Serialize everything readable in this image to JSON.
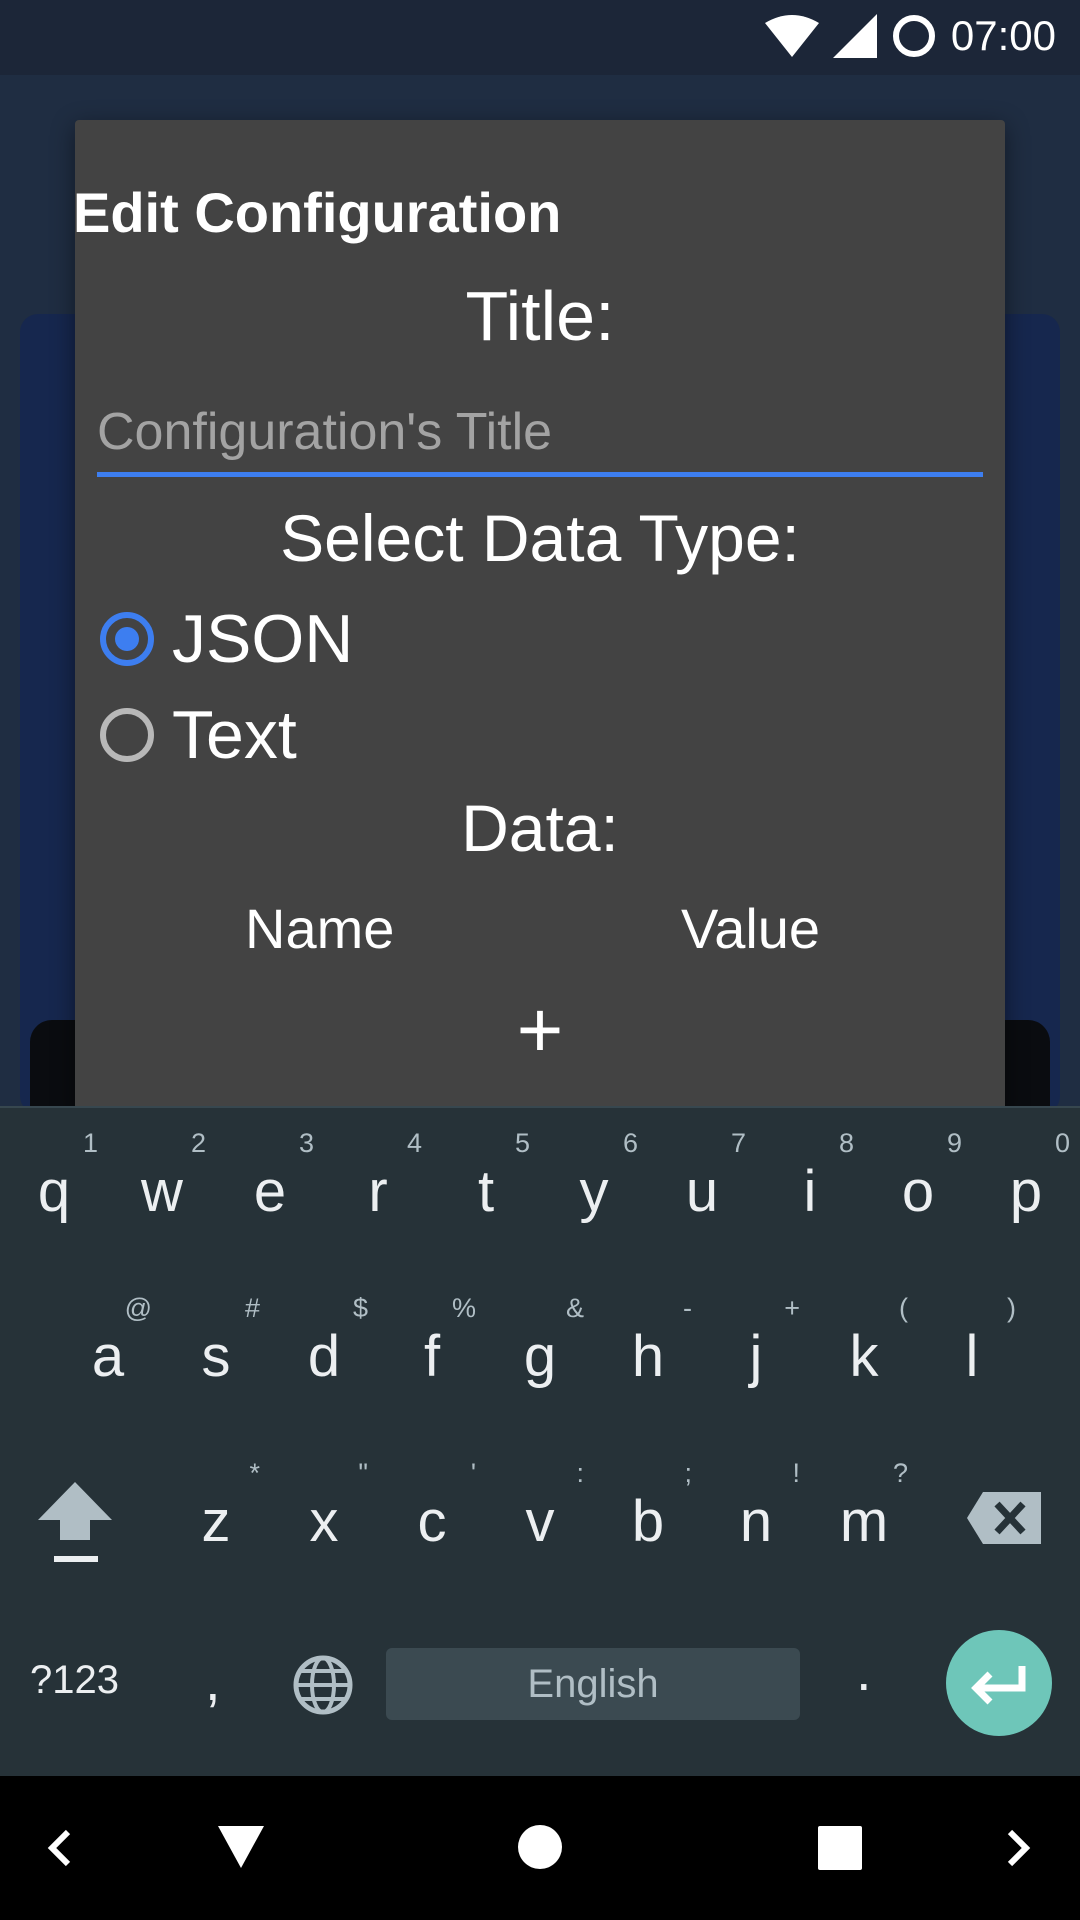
{
  "status_bar": {
    "time": "07:00",
    "icons": [
      "wifi-icon",
      "cell-signal-icon",
      "sync-icon"
    ]
  },
  "dialog": {
    "title": "Edit Configuration",
    "title_label": "Title:",
    "title_input": {
      "value": "",
      "placeholder": "Configuration's Title"
    },
    "data_type_label": "Select Data Type:",
    "data_types": [
      {
        "label": "JSON",
        "checked": true
      },
      {
        "label": "Text",
        "checked": false
      }
    ],
    "data_label": "Data:",
    "columns": [
      "Name",
      "Value"
    ],
    "add_label": "+"
  },
  "keyboard": {
    "rows": [
      [
        {
          "key": "q",
          "hint": "1"
        },
        {
          "key": "w",
          "hint": "2"
        },
        {
          "key": "e",
          "hint": "3"
        },
        {
          "key": "r",
          "hint": "4"
        },
        {
          "key": "t",
          "hint": "5"
        },
        {
          "key": "y",
          "hint": "6"
        },
        {
          "key": "u",
          "hint": "7"
        },
        {
          "key": "i",
          "hint": "8"
        },
        {
          "key": "o",
          "hint": "9"
        },
        {
          "key": "p",
          "hint": "0"
        }
      ],
      [
        {
          "key": "a",
          "hint": "@"
        },
        {
          "key": "s",
          "hint": "#"
        },
        {
          "key": "d",
          "hint": "$"
        },
        {
          "key": "f",
          "hint": "%"
        },
        {
          "key": "g",
          "hint": "&"
        },
        {
          "key": "h",
          "hint": "-"
        },
        {
          "key": "j",
          "hint": "+"
        },
        {
          "key": "k",
          "hint": "("
        },
        {
          "key": "l",
          "hint": ")"
        }
      ],
      [
        {
          "key": "z",
          "hint": "*"
        },
        {
          "key": "x",
          "hint": "\""
        },
        {
          "key": "c",
          "hint": "'"
        },
        {
          "key": "v",
          "hint": ":"
        },
        {
          "key": "b",
          "hint": ";"
        },
        {
          "key": "n",
          "hint": "!"
        },
        {
          "key": "m",
          "hint": "?"
        }
      ]
    ],
    "symbols_label": "?123",
    "comma_label": ",",
    "space_label": "English",
    "period_label": ".",
    "icons": [
      "shift-icon",
      "backspace-icon",
      "globe-icon",
      "enter-icon"
    ],
    "enter_color": "#6ec6b9"
  },
  "nav_bar": {
    "icons": [
      "left-arrow-icon",
      "back-icon",
      "home-icon",
      "recents-icon",
      "right-arrow-icon"
    ]
  },
  "colors": {
    "accent": "#3d7ef0",
    "dialog_bg": "#434343",
    "keyboard_bg": "#263238"
  }
}
